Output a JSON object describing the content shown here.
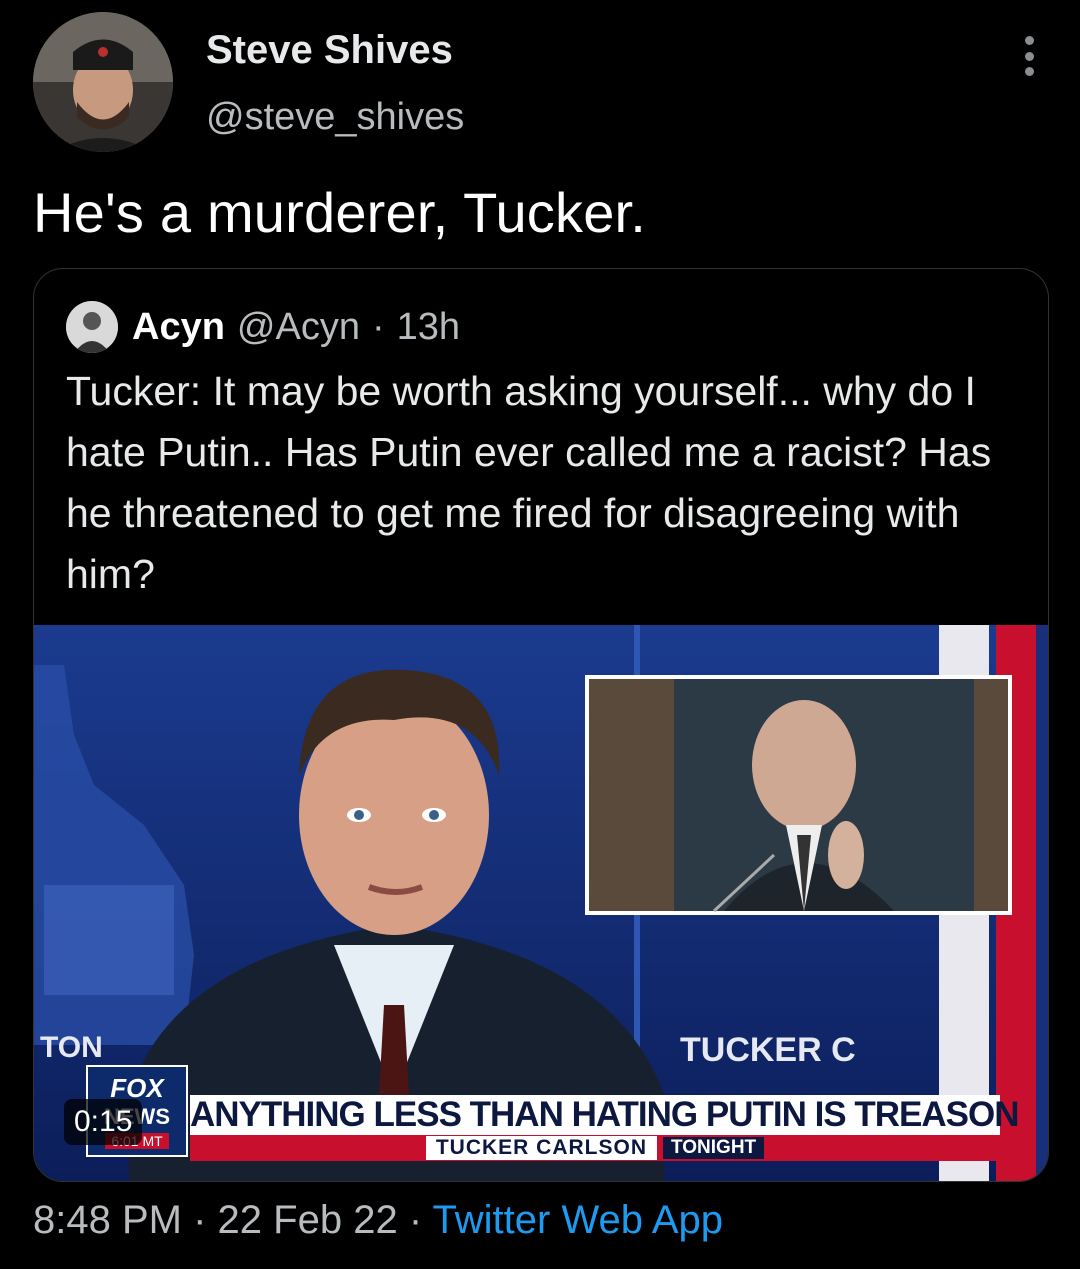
{
  "author": {
    "display_name": "Steve Shives",
    "handle": "@steve_shives"
  },
  "tweet": {
    "text": "He's a murderer, Tucker."
  },
  "quoted_tweet": {
    "author_name": "Acyn",
    "author_handle": "@Acyn",
    "separator": "·",
    "time": "13h",
    "text": "Tucker: It may be worth asking yourself... why do I hate Putin.. Has Putin ever called me a racist? Has he threatened to get me fired for disagreeing with him?",
    "media": {
      "duration": "0:15",
      "headline": "ANYTHING LESS THAN HATING PUTIN IS TREASON",
      "show_name": "TUCKER CARLSON",
      "show_tag": "TONIGHT",
      "logo_top": "FOX",
      "logo_bottom": "NEWS",
      "clock": "6:01 MT",
      "screen_label_right": "TUCKER C",
      "screen_label_left": "TON"
    }
  },
  "footer": {
    "time": "8:48 PM",
    "separator": "·",
    "date": "22 Feb 22",
    "source": "Twitter Web App"
  },
  "colors": {
    "background": "#000000",
    "link_blue": "#1d9bf0",
    "fox_red": "#c8102e",
    "fox_navy": "#0d1840"
  },
  "icons": {
    "more": "more-vertical-icon"
  }
}
